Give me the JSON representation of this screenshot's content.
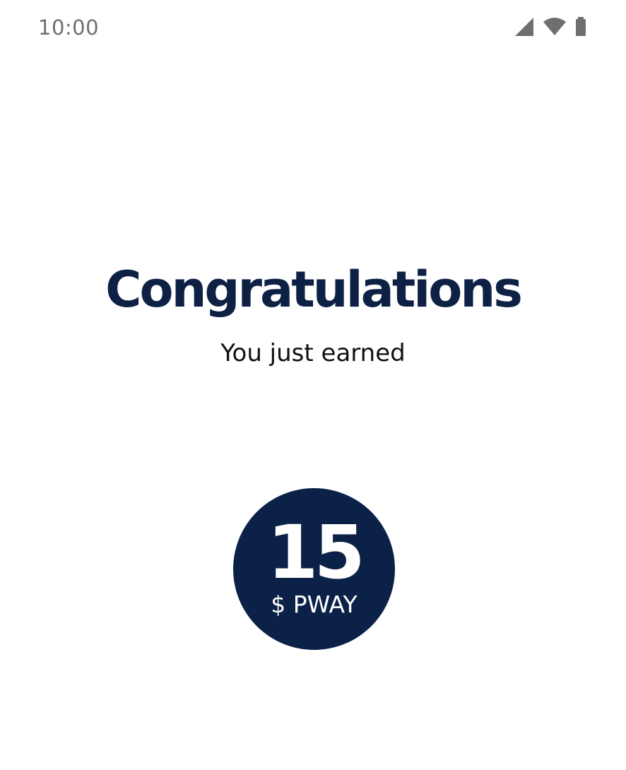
{
  "status_bar": {
    "time": "10:00",
    "icons": [
      "signal-icon",
      "wifi-icon",
      "battery-icon"
    ],
    "icon_color": "#6f6f6f"
  },
  "main": {
    "headline": "Congratulations",
    "subheadline": "You just earned"
  },
  "reward": {
    "amount": "15",
    "unit": "$ PWAY",
    "badge_color": "#0c2147"
  },
  "colors": {
    "headline": "#0d2145",
    "background": "#ffffff"
  }
}
